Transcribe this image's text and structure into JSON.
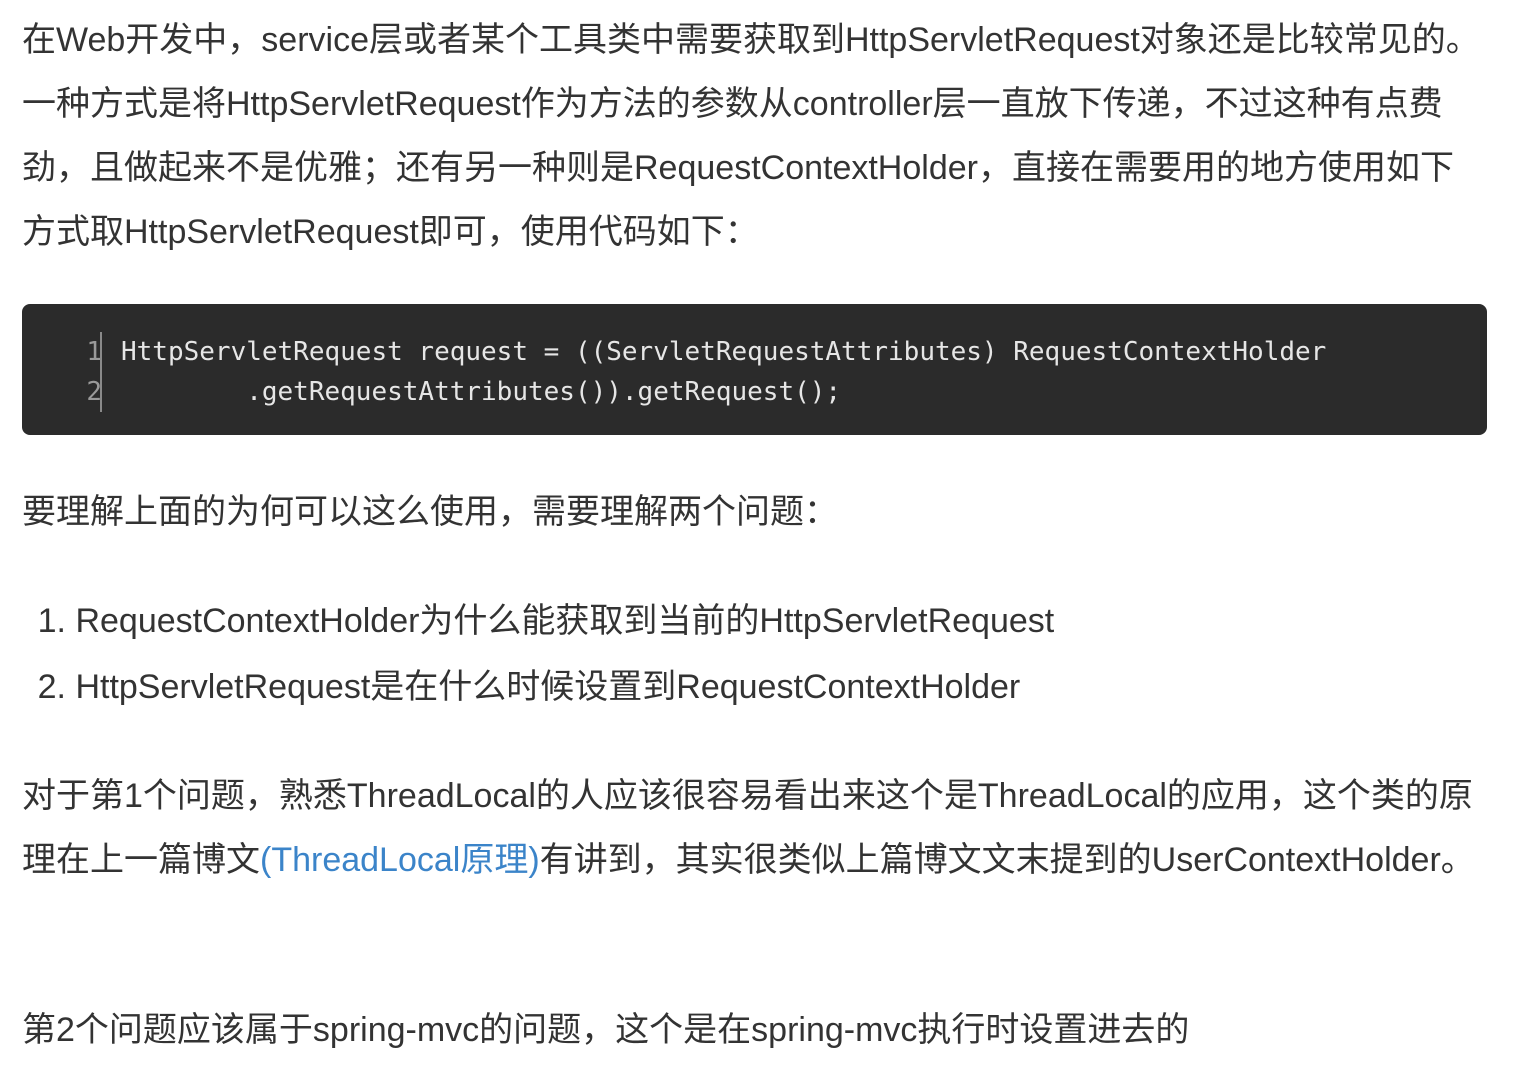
{
  "paragraph1": {
    "text": "在Web开发中，service层或者某个工具类中需要获取到HttpServletRequest对象还是比较常见的。一种方式是将HttpServletRequest作为方法的参数从controller层一直放下传递，不过这种有点费劲，且做起来不是优雅；还有另一种则是RequestContextHolder，直接在需要用的地方使用如下方式取HttpServletRequest即可，使用代码如下："
  },
  "code": {
    "line_numbers": [
      "1",
      "2"
    ],
    "lines": [
      "HttpServletRequest request = ((ServletRequestAttributes) RequestContextHolder",
      "        .getRequestAttributes()).getRequest();"
    ]
  },
  "paragraph2": {
    "text": "要理解上面的为何可以这么使用，需要理解两个问题："
  },
  "list": {
    "items": [
      {
        "number": "1.",
        "text": "RequestContextHolder为什么能获取到当前的HttpServletRequest"
      },
      {
        "number": "2.",
        "text": "HttpServletRequest是在什么时候设置到RequestContextHolder"
      }
    ]
  },
  "paragraph3": {
    "before_link": "对于第1个问题，熟悉ThreadLocal的人应该很容易看出来这个是ThreadLocal的应用，这个类的原理在上一篇博文",
    "link": "(ThreadLocal原理)",
    "after_link": "有讲到，其实很类似上篇博文文末提到的UserContextHolder。"
  },
  "paragraph4": {
    "text": "第2个问题应该属于spring-mvc的问题，这个是在spring-mvc执行时设置进去的"
  },
  "colors": {
    "text": "#333333",
    "link": "#3b84c9",
    "code_background": "#2b2b2b",
    "code_text": "#e6e6e6",
    "line_number": "#9a9a9a"
  }
}
